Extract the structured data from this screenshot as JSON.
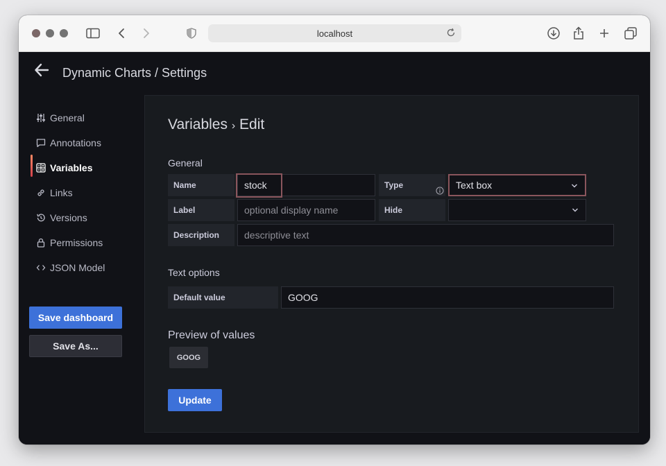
{
  "browser": {
    "url": "localhost"
  },
  "header": {
    "title": "Dynamic Charts / Settings"
  },
  "sidebar": {
    "items": [
      {
        "label": "General",
        "icon": "sliders-icon"
      },
      {
        "label": "Annotations",
        "icon": "comment-icon"
      },
      {
        "label": "Variables",
        "icon": "calculator-icon",
        "active": true
      },
      {
        "label": "Links",
        "icon": "link-icon"
      },
      {
        "label": "Versions",
        "icon": "history-icon"
      },
      {
        "label": "Permissions",
        "icon": "lock-icon"
      },
      {
        "label": "JSON Model",
        "icon": "code-icon"
      }
    ],
    "save_dashboard": "Save dashboard",
    "save_as": "Save As..."
  },
  "editor": {
    "title": "Variables",
    "title_separator": "›",
    "title_action": "Edit",
    "general_heading": "General",
    "name_label": "Name",
    "name_value": "stock",
    "type_label": "Type",
    "type_value": "Text box",
    "label_label": "Label",
    "label_placeholder": "optional display name",
    "hide_label": "Hide",
    "hide_value": "",
    "description_label": "Description",
    "description_placeholder": "descriptive text",
    "text_options_heading": "Text options",
    "default_value_label": "Default value",
    "default_value": "GOOG",
    "preview_heading": "Preview of values",
    "preview_values": [
      "GOOG"
    ],
    "update_button": "Update"
  },
  "colors": {
    "primary": "#3d71d9",
    "page_bg": "#111217",
    "panel_bg": "#181b1f",
    "highlight": "#8a555c"
  }
}
